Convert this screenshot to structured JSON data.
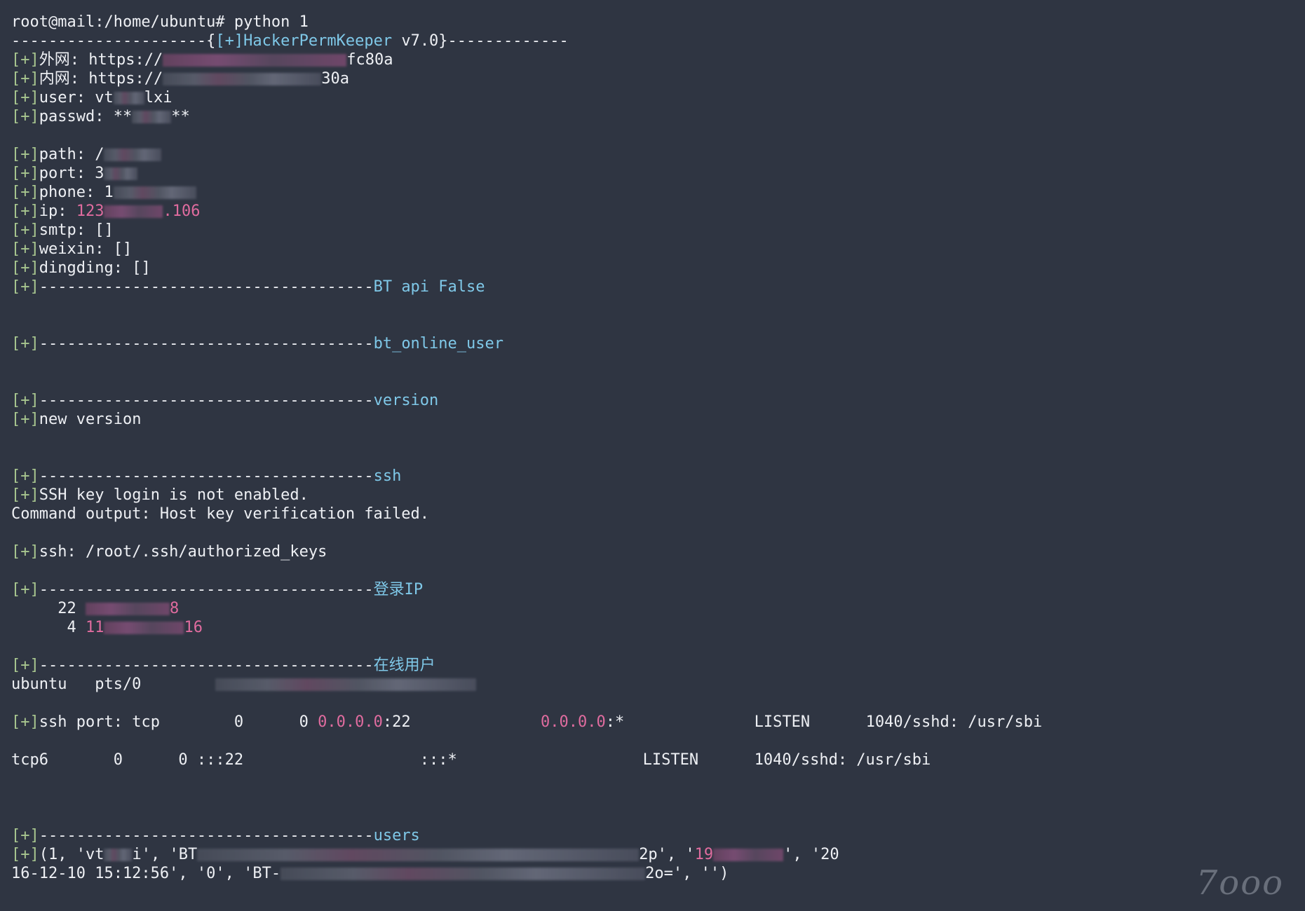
{
  "prompt": "root@mail:/home/ubuntu# python 1",
  "banner": {
    "left": "---------------------{",
    "tag": "[+]HackerPermKeeper",
    "right": " v7.0}-------------"
  },
  "prefix": "[+]",
  "info": {
    "waiwang_label": "外网: ",
    "waiwang_value_start": "https://",
    "waiwang_value_end": "fc80a",
    "neiwang_label": "内网: ",
    "neiwang_value_start": "https://",
    "neiwang_value_end": "30a",
    "user_label": "user: ",
    "user_value_start": "vt",
    "user_value_end": "lxi",
    "passwd_label": "passwd: ",
    "passwd_value_start": "**",
    "passwd_value_end": "**",
    "path_label": "path: ",
    "path_value_start": "/",
    "port_label": "port: ",
    "port_value_start": "3",
    "phone_label": "phone: ",
    "phone_value_start": "1",
    "ip_label": "ip: ",
    "ip_value_start": "123",
    "ip_value_end": ".106",
    "smtp_line": "smtp: []",
    "weixin_line": "weixin: []",
    "dingding_line": "dingding: []"
  },
  "sections": {
    "dashes": "------------------------------------",
    "bt_api": "BT api False",
    "bt_online_user": "bt_online_user",
    "version": "version",
    "new_version": "new version",
    "ssh": "ssh",
    "ssh_key": "SSH key login is not enabled.",
    "cmd_output": "Command output: Host key verification failed.",
    "ssh_path": "ssh: /root/.ssh/authorized_keys",
    "login_ip": "登录IP",
    "login_row1_count": "     22 ",
    "login_row1_end": "8",
    "login_row2_count": "      4 ",
    "login_row2_start": "11",
    "login_row2_end": "16",
    "online_users": "在线用户",
    "online_row": "ubuntu   pts/0        ",
    "ssh_port_label": "ssh port: tcp        0      0 ",
    "ssh_port_addr1": "0.0.0.0",
    "ssh_port_mid": ":22              ",
    "ssh_port_addr2": "0.0.0.0",
    "ssh_port_tail": ":*              LISTEN      1040/sshd: /usr/sbi",
    "tcp6_line": "tcp6       0      0 :::22                   :::*                    LISTEN      1040/sshd: /usr/sbi",
    "users": "users",
    "users_row1_start": "(1, 'vt",
    "users_row1_mid": "i', 'BT",
    "users_row1_mid2": "2p', '",
    "users_row1_pink": "19",
    "users_row1_end": "', '20",
    "users_row2_start": "16-12-10 15:12:56', '0', 'BT-",
    "users_row2_end": "2o=', '')"
  },
  "watermark": "7ooo"
}
